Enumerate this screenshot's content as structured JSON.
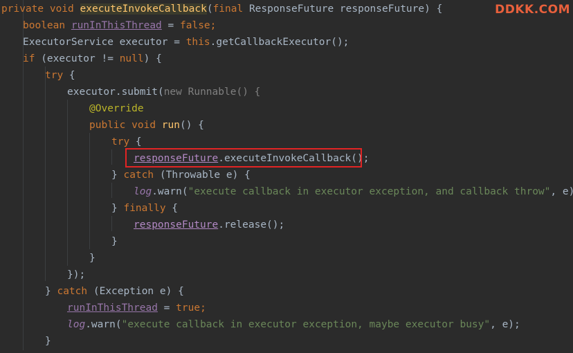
{
  "brand": "DDKK.COM",
  "code": {
    "l1": {
      "p1": "private",
      "p2": "void",
      "name": "executeInvokeCallback",
      "p3": "(",
      "p4": "final",
      "p5": "ResponseFuture responseFuture) {"
    },
    "l2": {
      "t1": "boolean",
      "v": "runInThisThread",
      "t2": " = ",
      "t3": "false",
      "t4": ";"
    },
    "l3": {
      "t1": "ExecutorService executor = ",
      "t2": "this",
      "t3": ".getCallbackExecutor();"
    },
    "l4": {
      "t1": "if",
      "t2": " (executor != ",
      "t3": "null",
      "t4": ") {"
    },
    "l5": {
      "t1": "try",
      "t2": " {"
    },
    "l6": {
      "t1": "executor.submit(",
      "t2": "new",
      "t3": " Runnable() {"
    },
    "l7": {
      "t1": "@Override"
    },
    "l8": {
      "t1": "public",
      "t2": "void",
      "t3": "run",
      "t4": "() {"
    },
    "l9": {
      "t1": "try",
      "t2": " {"
    },
    "l10": {
      "t1": "responseFuture",
      "t2": ".executeInvokeCallback();"
    },
    "l11": {
      "t1": "} ",
      "t2": "catch",
      "t3": " (Throwable e) {"
    },
    "l12": {
      "t1": "log",
      "t2": ".warn(",
      "t3": "\"execute callback in executor exception, and callback throw\"",
      "t4": ", e);"
    },
    "l13": {
      "t1": "} ",
      "t2": "finally",
      "t3": " {"
    },
    "l14": {
      "t1": "responseFuture",
      "t2": ".release();"
    },
    "l15": {
      "t1": "}"
    },
    "l16": {
      "t1": "}"
    },
    "l17": {
      "t1": "});"
    },
    "l18": {
      "t1": "} ",
      "t2": "catch",
      "t3": " (Exception e) {"
    },
    "l19": {
      "t1": "runInThisThread",
      "t2": " = ",
      "t3": "true",
      "t4": ";"
    },
    "l20": {
      "t1": "log",
      "t2": ".warn(",
      "t3": "\"execute callback in executor exception, maybe executor busy\"",
      "t4": ", e);"
    },
    "l21": {
      "t1": "}"
    }
  },
  "colors": {
    "background": "#2b2b2b",
    "keyword": "#cc7832",
    "string": "#6a8759",
    "method_declaration": "#ffc66d",
    "field": "#9876aa",
    "annotation": "#bbb529",
    "highlight_border": "#e32424",
    "brand": "#e8603c"
  }
}
